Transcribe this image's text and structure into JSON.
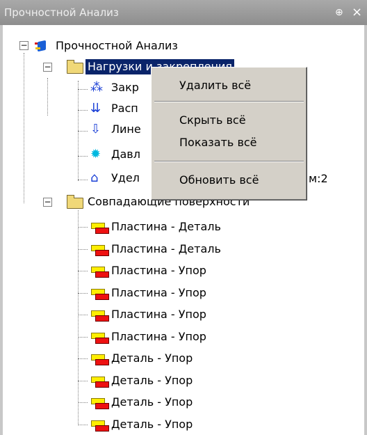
{
  "window": {
    "title": "Прочностной Анализ",
    "pin_glyph": "⊕",
    "close_glyph": "×"
  },
  "tree": {
    "root": {
      "label": "Прочностной Анализ",
      "icon": "analysis-icon",
      "expander": "−"
    },
    "loads_folder": {
      "label": "Нагрузки и закрепления",
      "icon": "folder-icon",
      "expander": "−",
      "children": [
        {
          "label": "Закр",
          "icon": "fixture-icon"
        },
        {
          "label": "Расп",
          "icon": "distributed-load-icon"
        },
        {
          "label": "Лине",
          "icon": "linear-load-icon"
        },
        {
          "label": "Давл",
          "icon": "pressure-icon"
        },
        {
          "label": "Удел",
          "icon": "specific-load-icon",
          "suffix": "м:2"
        }
      ]
    },
    "contacts_folder": {
      "label": "Совпадающие поверхности",
      "icon": "folder-icon",
      "expander": "−",
      "children": [
        {
          "label": "Пластина - Деталь"
        },
        {
          "label": "Пластина - Деталь"
        },
        {
          "label": "Пластина - Упор"
        },
        {
          "label": "Пластина - Упор"
        },
        {
          "label": "Пластина - Упор"
        },
        {
          "label": "Пластина - Упор"
        },
        {
          "label": "Деталь - Упор"
        },
        {
          "label": "Деталь - Упор"
        },
        {
          "label": "Деталь - Упор"
        },
        {
          "label": "Деталь - Упор"
        }
      ]
    }
  },
  "context_menu": {
    "items": [
      "Удалить всё",
      "Скрыть всё",
      "Показать всё",
      "Обновить всё"
    ]
  },
  "colors": {
    "selection": "#0a246a",
    "menu_bg": "#d4d0c8",
    "titlebar": "#9b9b9b"
  }
}
